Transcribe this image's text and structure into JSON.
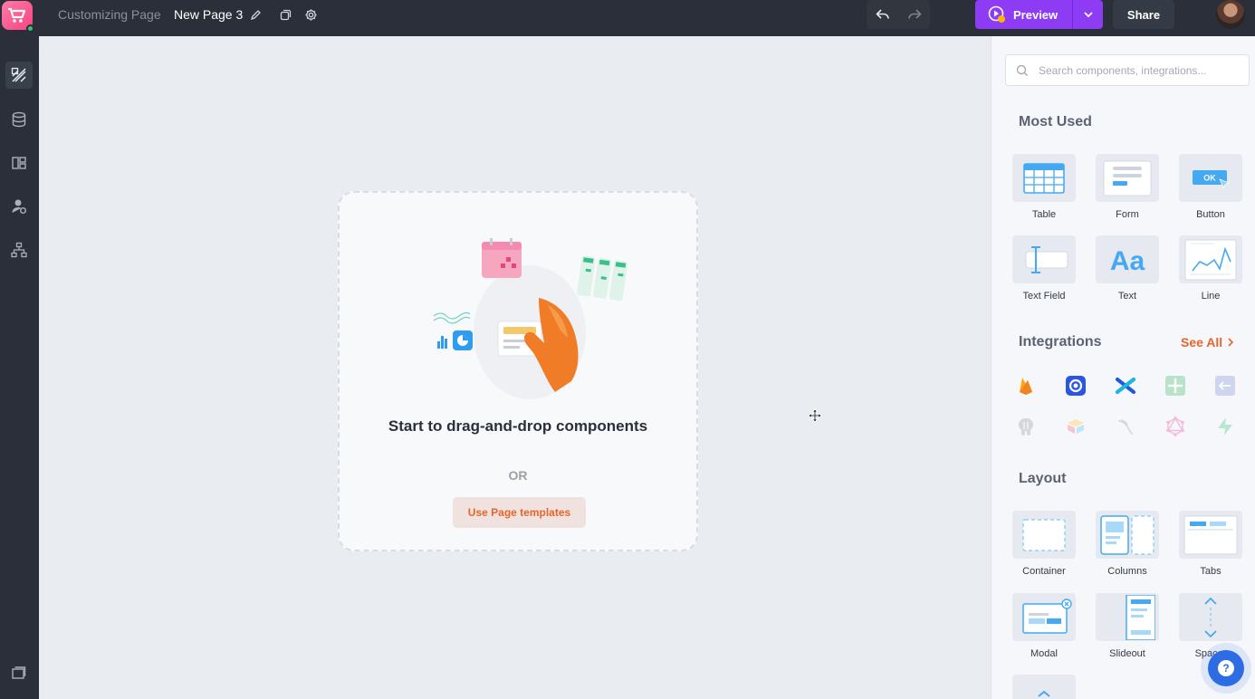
{
  "app": {
    "breadcrumb": "Customizing Page",
    "page_name": "New Page 3",
    "accent_color": "#8d3cf3",
    "brand_color": "#f5457f"
  },
  "toolbar": {
    "preview_label": "Preview",
    "share_label": "Share"
  },
  "canvas": {
    "title": "Start to drag-and-drop components",
    "or_text": "OR",
    "template_button": "Use Page templates"
  },
  "panel": {
    "search_placeholder": "Search components, integrations...",
    "most_used": {
      "title": "Most Used",
      "items": [
        "Table",
        "Form",
        "Button",
        "Text Field",
        "Text",
        "Line"
      ]
    },
    "integrations": {
      "title": "Integrations",
      "see_all": "See All",
      "icons": [
        "firebase-icon",
        "obsidian-icon",
        "xano-icon",
        "sheets-icon",
        "api-icon",
        "postgres-icon",
        "airtable-icon",
        "mysql-icon",
        "graphql-icon",
        "supabase-icon"
      ]
    },
    "layout": {
      "title": "Layout",
      "items": [
        "Container",
        "Columns",
        "Tabs",
        "Modal",
        "Slideout",
        "Spacer"
      ]
    }
  }
}
